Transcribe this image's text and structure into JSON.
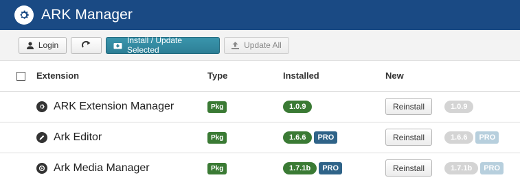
{
  "header": {
    "title": "ARK Manager",
    "logo_icon": "gear-icon"
  },
  "toolbar": {
    "login_label": "Login",
    "install_label": "Install / Update Selected",
    "update_all_label": "Update All"
  },
  "table": {
    "columns": [
      "Extension",
      "Type",
      "Installed",
      "New"
    ],
    "rows": [
      {
        "name": "ARK Extension Manager",
        "icon": "gear-icon",
        "type": "Pkg",
        "installed": "1.0.9",
        "installed_pro": "",
        "action": "Reinstall",
        "new": "1.0.9",
        "new_pro": ""
      },
      {
        "name": "Ark Editor",
        "icon": "pencil-icon",
        "type": "Pkg",
        "installed": "1.6.6",
        "installed_pro": "PRO",
        "action": "Reinstall",
        "new": "1.6.6",
        "new_pro": "PRO"
      },
      {
        "name": "Ark Media Manager",
        "icon": "play-icon",
        "type": "Pkg",
        "installed": "1.7.1b",
        "installed_pro": "PRO",
        "action": "Reinstall",
        "new": "1.7.1b",
        "new_pro": "PRO"
      }
    ]
  },
  "colors": {
    "header_bg": "#1a4a84",
    "accent_teal": "#2d7f96",
    "pkg_green": "#3a7a34",
    "pro_blue": "#2f6388"
  }
}
